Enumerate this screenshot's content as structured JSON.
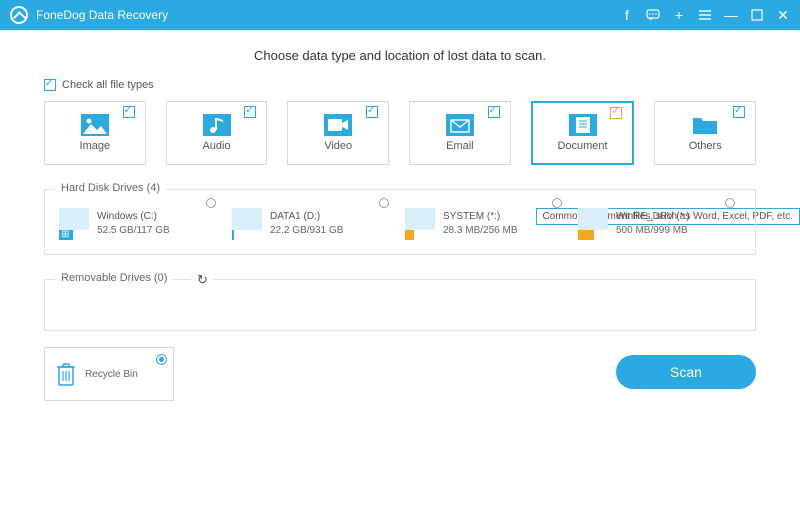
{
  "titlebar": {
    "title": "FoneDog Data Recovery"
  },
  "heading": "Choose data type and location of lost data to scan.",
  "check_all_label": "Check all file types",
  "types": [
    {
      "key": "image",
      "label": "Image",
      "checked": true,
      "selected": false,
      "color": "blue"
    },
    {
      "key": "audio",
      "label": "Audio",
      "checked": true,
      "selected": false,
      "color": "blue"
    },
    {
      "key": "video",
      "label": "Video",
      "checked": true,
      "selected": false,
      "color": "blue"
    },
    {
      "key": "email",
      "label": "Email",
      "checked": true,
      "selected": false,
      "color": "blue"
    },
    {
      "key": "document",
      "label": "Document",
      "checked": true,
      "selected": true,
      "color": "orange"
    },
    {
      "key": "others",
      "label": "Others",
      "checked": true,
      "selected": false,
      "color": "blue"
    }
  ],
  "tooltip": "Common document files, such as Word, Excel, PDF, etc.",
  "sections": {
    "hdd_legend": "Hard Disk Drives (4)",
    "removable_legend": "Removable Drives (0)"
  },
  "drives": [
    {
      "name": "Windows (C:)",
      "size": "52.5 GB/117 GB",
      "used_pct": 45,
      "color": "blue",
      "win": true
    },
    {
      "name": "DATA1 (D:)",
      "size": "22.2 GB/931 GB",
      "used_pct": 8,
      "color": "blue",
      "win": false
    },
    {
      "name": "SYSTEM (*:)",
      "size": "28.3 MB/256 MB",
      "used_pct": 30,
      "color": "orange",
      "win": false
    },
    {
      "name": "WinRE_DRV (*:)",
      "size": "500 MB/999 MB",
      "used_pct": 52,
      "color": "orange",
      "win": false
    }
  ],
  "recycle": {
    "label": "Recycle Bin",
    "selected": true
  },
  "scan_label": "Scan"
}
